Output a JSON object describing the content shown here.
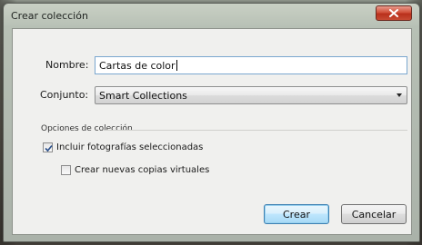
{
  "window": {
    "title": "Crear colección"
  },
  "form": {
    "name_label": "Nombre:",
    "name_value": "Cartas de color",
    "set_label": "Conjunto:",
    "set_value": "Smart Collections"
  },
  "options": {
    "group_title": "Opciones de colección",
    "include_selected_label": "Incluir fotografías seleccionadas",
    "include_selected_checked": true,
    "virtual_copies_label": "Crear nuevas copias virtuales",
    "virtual_copies_checked": false
  },
  "buttons": {
    "create_label": "Crear",
    "cancel_label": "Cancelar"
  },
  "colors": {
    "close_button": "#c8442e",
    "default_button_border": "#3c7fb1"
  }
}
